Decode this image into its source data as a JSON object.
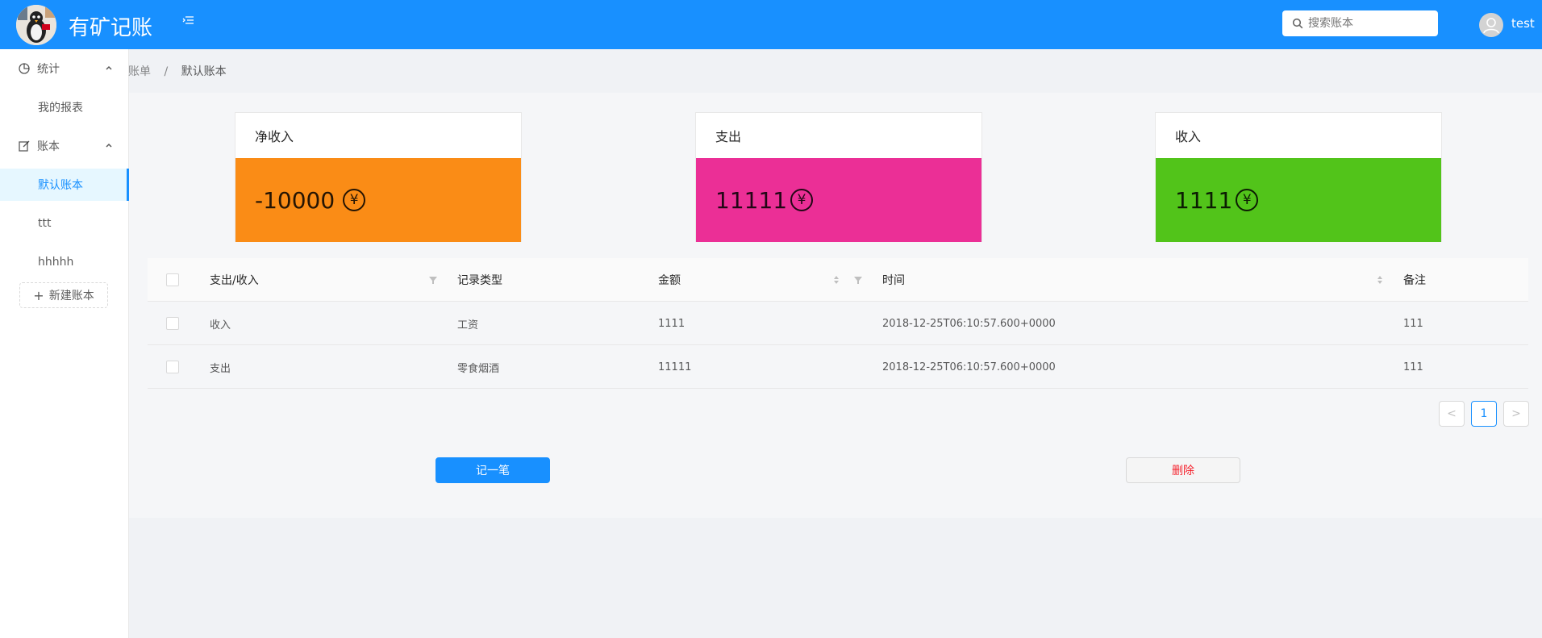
{
  "header": {
    "brand": "有矿记账",
    "search_placeholder": "搜索账本",
    "username": "test"
  },
  "sidebar": {
    "groups": [
      {
        "label": "统计",
        "icon": "pie-chart-icon",
        "items": [
          "我的报表"
        ]
      },
      {
        "label": "账本",
        "icon": "edit-icon",
        "items": [
          "默认账本",
          "ttt",
          "hhhhh"
        ]
      }
    ],
    "active_item": "默认账本",
    "new_book_label": "新建账本"
  },
  "breadcrumb": {
    "parent": "账单",
    "separator": "/",
    "current": "默认账本"
  },
  "stats": [
    {
      "title": "净收入",
      "value": "-10000",
      "color": "#fa8c16"
    },
    {
      "title": "支出",
      "value": "11111",
      "color": "#eb2f96"
    },
    {
      "title": "收入",
      "value": "1111",
      "color": "#52c41a"
    }
  ],
  "currency_symbol": "¥",
  "table": {
    "columns": [
      "支出/收入",
      "记录类型",
      "金额",
      "时间",
      "备注"
    ],
    "rows": [
      [
        "收入",
        "工资",
        "1111",
        "2018-12-25T06:10:57.600+0000",
        "111"
      ],
      [
        "支出",
        "零食烟酒",
        "11111",
        "2018-12-25T06:10:57.600+0000",
        "111"
      ]
    ]
  },
  "pagination": {
    "current": "1",
    "prev": "<",
    "next": ">"
  },
  "actions": {
    "add_label": "记一笔",
    "delete_label": "删除"
  },
  "colors": {
    "primary": "#1890ff",
    "danger": "#f5222d"
  }
}
